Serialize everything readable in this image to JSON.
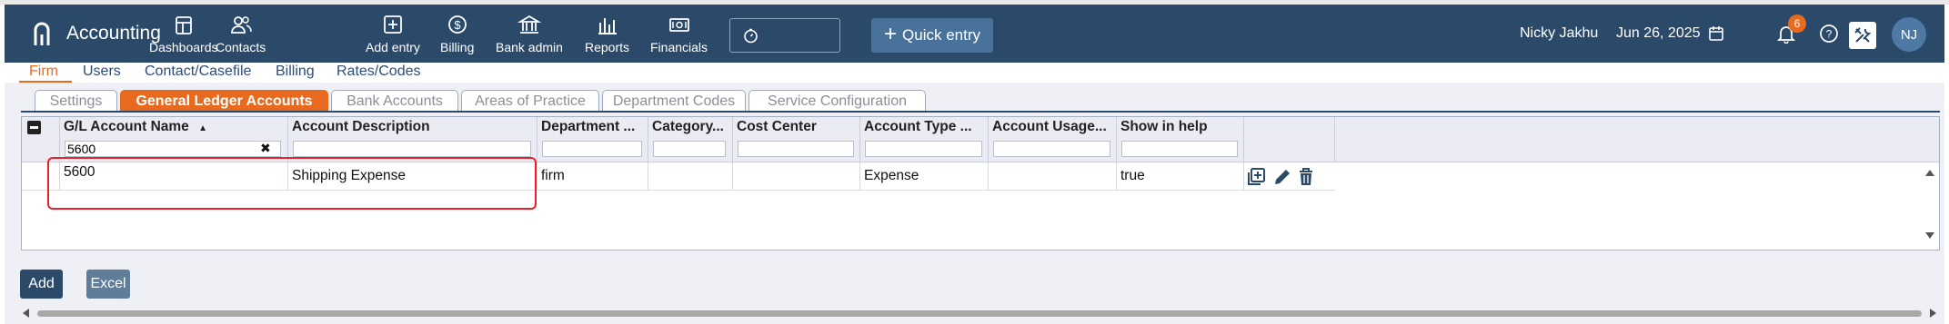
{
  "app": {
    "title": "Accounting"
  },
  "nav": {
    "items": [
      {
        "label": "Dashboards",
        "icon": "dashboard-icon"
      },
      {
        "label": "Contacts",
        "icon": "contacts-icon"
      },
      {
        "label": "Add entry",
        "icon": "add-entry-icon"
      },
      {
        "label": "Billing",
        "icon": "billing-icon"
      },
      {
        "label": "Bank admin",
        "icon": "bank-icon"
      },
      {
        "label": "Reports",
        "icon": "reports-icon"
      },
      {
        "label": "Financials",
        "icon": "financials-icon"
      }
    ],
    "quick_entry_label": "Quick entry",
    "user_name": "Nicky Jakhu",
    "date": "Jun 26, 2025",
    "notification_count": "6",
    "avatar_initials": "NJ"
  },
  "subnav": {
    "items": [
      "Firm",
      "Users",
      "Contact/Casefile",
      "Billing",
      "Rates/Codes"
    ],
    "active": "Firm"
  },
  "tabs": {
    "items": [
      "Settings",
      "General Ledger Accounts",
      "Bank Accounts",
      "Areas of Practice",
      "Department Codes",
      "Service Configuration"
    ],
    "active": "General Ledger Accounts"
  },
  "grid": {
    "columns": [
      "G/L Account Name",
      "Account Description",
      "Department ...",
      "Category...",
      "Cost Center",
      "Account Type ...",
      "Account Usage...",
      "Show in help"
    ],
    "sort": {
      "column": "G/L Account Name",
      "direction": "ascending"
    },
    "filters": {
      "gl_account_name": "5600"
    },
    "rows": [
      {
        "gl_account_name": "5600",
        "account_description": "Shipping Expense",
        "department": "firm",
        "category": "",
        "cost_center": "",
        "account_type": "Expense",
        "account_usage": "",
        "show_in_help": "true"
      }
    ]
  },
  "buttons": {
    "add": "Add",
    "excel": "Excel"
  },
  "colors": {
    "navbar": "#2b4a6a",
    "accent": "#e86a1f",
    "highlight": "#e8212b"
  }
}
